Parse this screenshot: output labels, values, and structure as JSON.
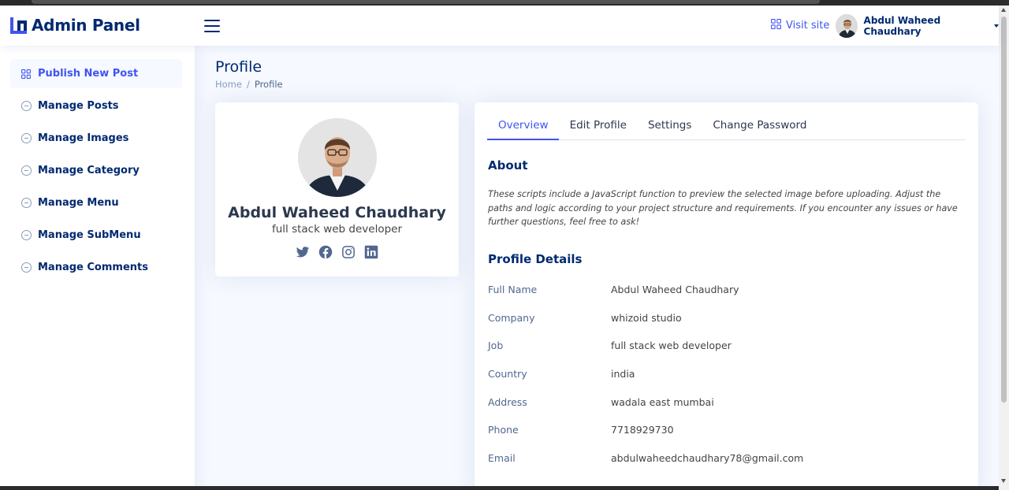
{
  "header": {
    "app_title": "Admin Panel",
    "visit_site_label": "Visit site",
    "user_name": "Abdul Waheed Chaudhary"
  },
  "sidebar": {
    "items": [
      {
        "label": "Publish New Post",
        "icon": "grid-icon",
        "active": true
      },
      {
        "label": "Manage Posts",
        "icon": "circle-minus-icon"
      },
      {
        "label": "Manage Images",
        "icon": "circle-minus-icon"
      },
      {
        "label": "Manage Category",
        "icon": "circle-minus-icon"
      },
      {
        "label": "Manage Menu",
        "icon": "circle-minus-icon"
      },
      {
        "label": "Manage SubMenu",
        "icon": "circle-minus-icon"
      },
      {
        "label": "Manage Comments",
        "icon": "circle-minus-icon"
      }
    ]
  },
  "page": {
    "title": "Profile",
    "breadcrumb": [
      "Home",
      "/",
      "Profile"
    ]
  },
  "profile_card": {
    "name": "Abdul Waheed Chaudhary",
    "job": "full stack web developer",
    "socials": [
      "twitter-icon",
      "facebook-icon",
      "instagram-icon",
      "linkedin-icon"
    ]
  },
  "details": {
    "tabs": [
      "Overview",
      "Edit Profile",
      "Settings",
      "Change Password"
    ],
    "active_tab": "Overview",
    "about_title": "About",
    "about_text": "These scripts include a JavaScript function to preview the selected image before uploading. Adjust the paths and logic according to your project structure and requirements. If you encounter any issues or have further questions, feel free to ask!",
    "profile_details_title": "Profile Details",
    "rows": [
      {
        "label": "Full Name",
        "value": "Abdul Waheed Chaudhary"
      },
      {
        "label": "Company",
        "value": "whizoid studio"
      },
      {
        "label": "Job",
        "value": "full stack web developer"
      },
      {
        "label": "Country",
        "value": "india"
      },
      {
        "label": "Address",
        "value": "wadala east mumbai"
      },
      {
        "label": "Phone",
        "value": "7718929730"
      },
      {
        "label": "Email",
        "value": "abdulwaheedchaudhary78@gmail.com"
      }
    ]
  },
  "colors": {
    "accent": "#4154f1",
    "navy": "#012970",
    "muted": "#899bbd",
    "background": "#f6f9ff"
  }
}
